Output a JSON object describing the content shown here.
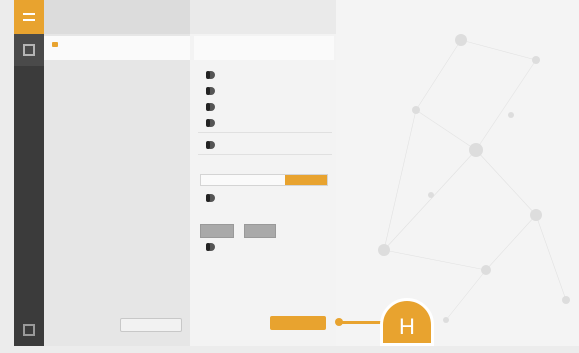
{
  "theme": {
    "accent": "#e8a32f",
    "rail": "#3b3b3b"
  },
  "rail": {
    "icons": [
      "menu-icon",
      "sessions-icon",
      "bottom-nav-icon"
    ]
  },
  "sessions": {
    "header": "",
    "items": [
      {
        "title": "",
        "subtitle": ""
      }
    ],
    "button_label": ""
  },
  "settings": {
    "header": "",
    "toggles_group1": [
      {
        "label": ""
      },
      {
        "label": ""
      },
      {
        "label": ""
      },
      {
        "label": ""
      }
    ],
    "toggle_single": {
      "label": ""
    },
    "section_segment_label": "",
    "segments": [
      {
        "label": ""
      },
      {
        "label": ""
      },
      {
        "label": "",
        "active": true
      }
    ],
    "toggle_after_segment": {
      "label": ""
    },
    "section_resolution_label": "",
    "resolution_separator": "",
    "toggle_after_resolution": {
      "label": ""
    },
    "save_label": ""
  },
  "callout": {
    "letter": "H"
  }
}
